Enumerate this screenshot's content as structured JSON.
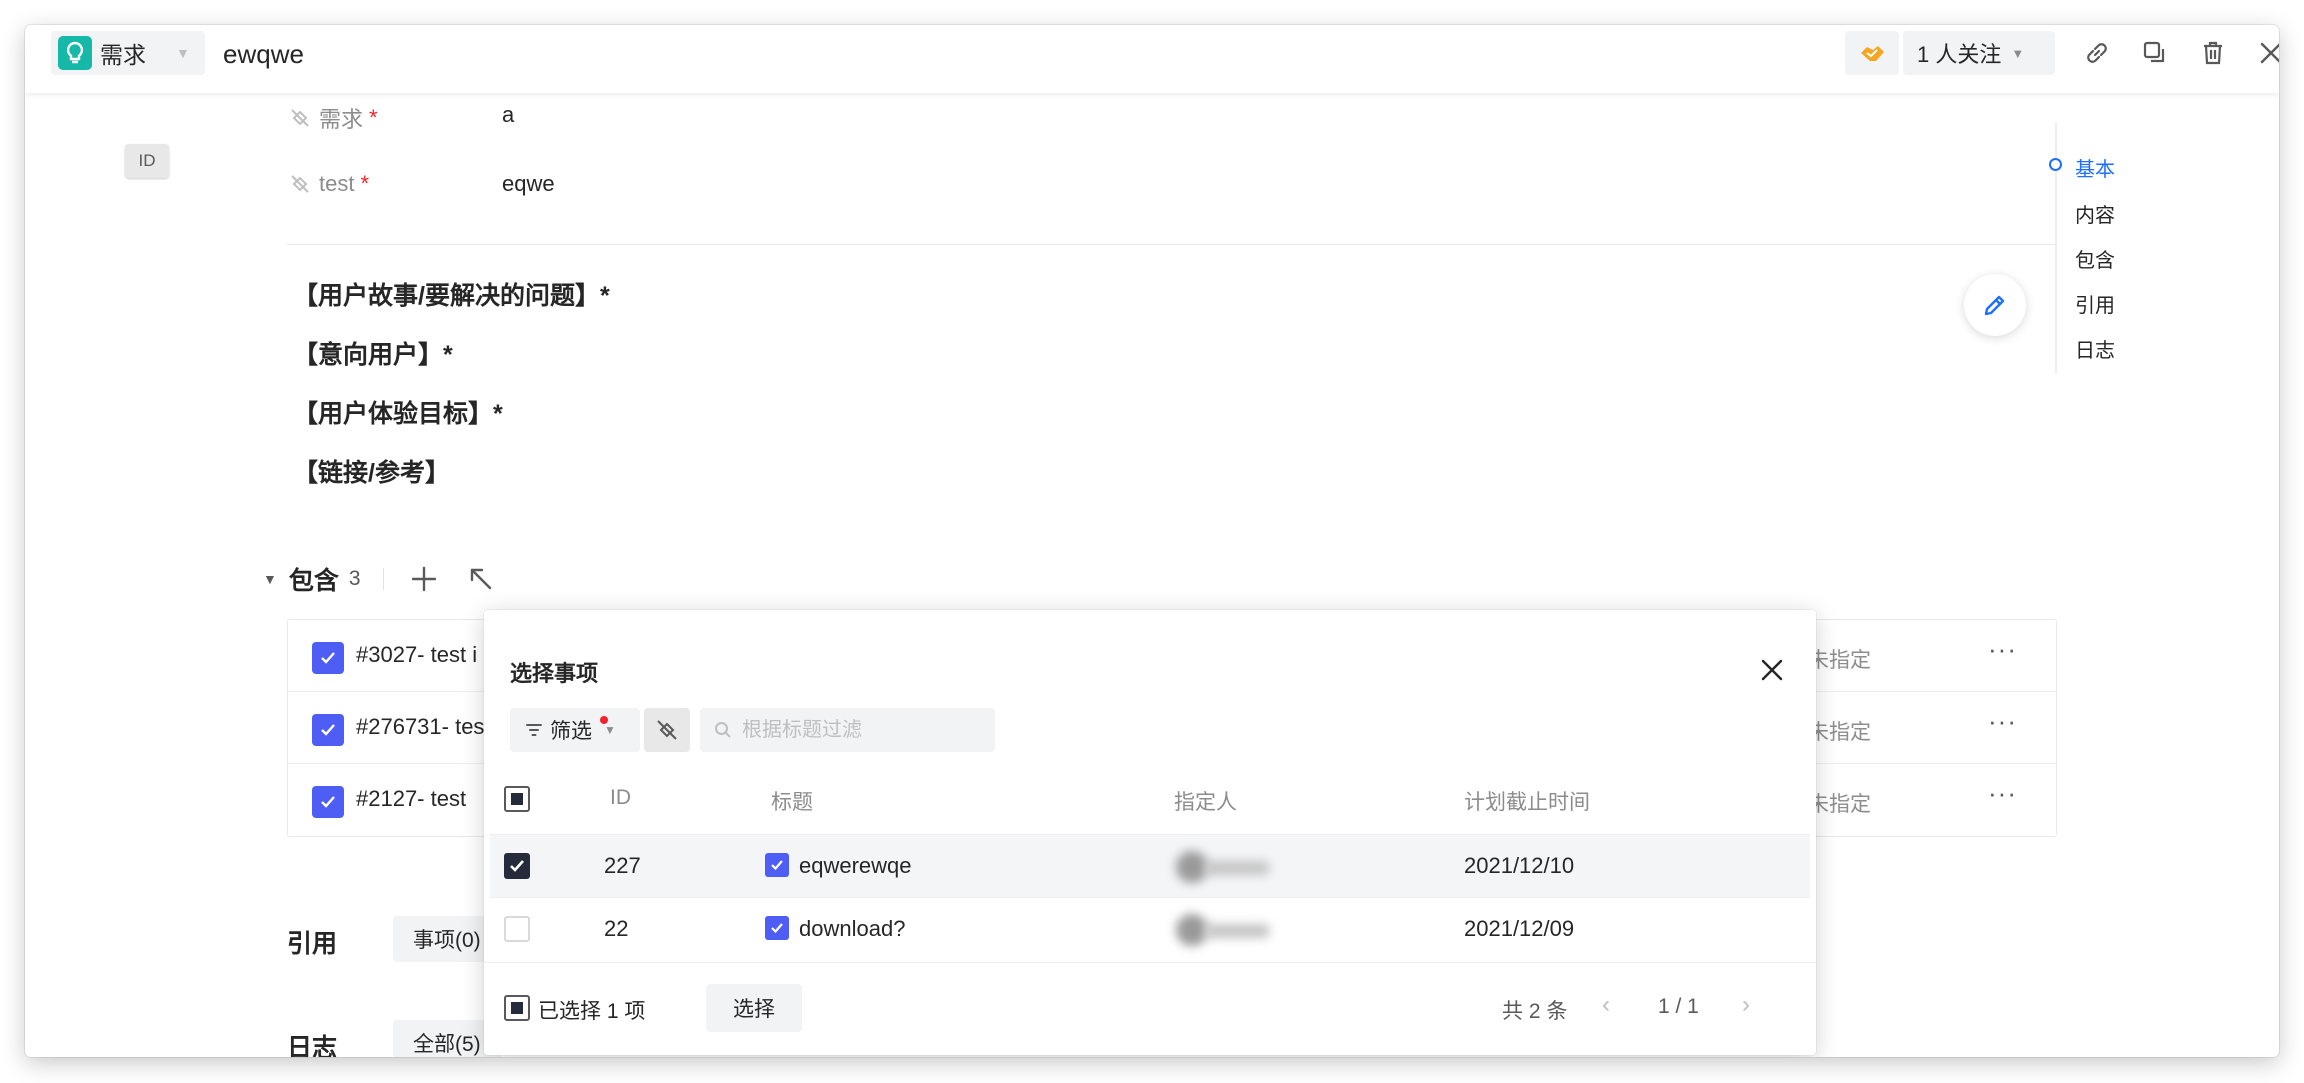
{
  "header": {
    "type_label": "需求",
    "title": "ewqwe",
    "follow_label": "1 人关注"
  },
  "id_chip": "ID",
  "fields": [
    {
      "label": "需求",
      "value": "a"
    },
    {
      "label": "test",
      "value": "eqwe"
    }
  ],
  "required_mark": "*",
  "content_lines": [
    "【用户故事/要解决的问题】*",
    "【意向用户】*",
    "【用户体验目标】*",
    "【链接/参考】"
  ],
  "right_nav": [
    "基本",
    "内容",
    "包含",
    "引用",
    "日志"
  ],
  "contains": {
    "label": "包含",
    "count": "3",
    "rows": [
      {
        "title": "#3027- test i",
        "assignee": "未指定"
      },
      {
        "title": "#276731- tes",
        "assignee": "未指定"
      },
      {
        "title": "#2127- test",
        "assignee": "未指定"
      }
    ],
    "more": "···"
  },
  "references": {
    "label": "引用",
    "chip": "事项(0)"
  },
  "log": {
    "label": "日志",
    "chip": "全部(5)"
  },
  "popup": {
    "title": "选择事项",
    "filter_label": "筛选",
    "search_placeholder": "根据标题过滤",
    "columns": [
      "ID",
      "标题",
      "指定人",
      "计划截止时间"
    ],
    "rows": [
      {
        "id": "227",
        "title": "eqwerewqe",
        "due": "2021/12/10",
        "selected": true
      },
      {
        "id": "22",
        "title": "download?",
        "due": "2021/12/09",
        "selected": false
      }
    ],
    "selected_text": "已选择 1 项",
    "select_button": "选择",
    "total": "共 2 条",
    "page": "1 / 1"
  },
  "colors": {
    "type_icon": "#16b8a8",
    "accent": "#1e6fff",
    "item_check": "#4e5ef5",
    "required": "#f5222d"
  }
}
